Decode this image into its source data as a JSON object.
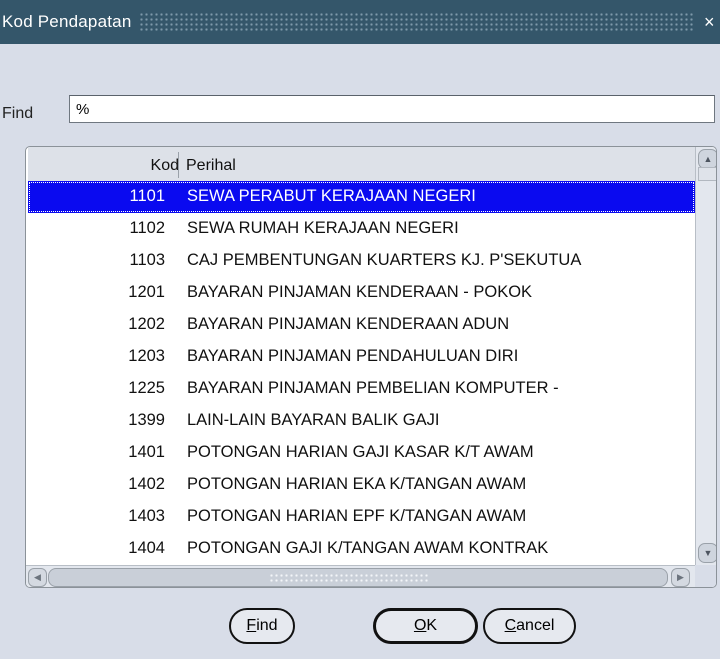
{
  "window": {
    "title": "Kod Pendapatan",
    "close_symbol": "×"
  },
  "search": {
    "label": "Find",
    "value": "%"
  },
  "table": {
    "columns": {
      "kod": "Kod",
      "perihal": "Perihal"
    },
    "selected_index": 0,
    "rows": [
      {
        "kod": "1101",
        "perihal": "SEWA PERABUT KERAJAAN NEGERI"
      },
      {
        "kod": "1102",
        "perihal": "SEWA RUMAH KERAJAAN NEGERI"
      },
      {
        "kod": "1103",
        "perihal": "CAJ PEMBENTUNGAN KUARTERS KJ. P'SEKUTUA"
      },
      {
        "kod": "1201",
        "perihal": "BAYARAN PINJAMAN KENDERAAN - POKOK"
      },
      {
        "kod": "1202",
        "perihal": "BAYARAN PINJAMAN KENDERAAN ADUN"
      },
      {
        "kod": "1203",
        "perihal": "BAYARAN PINJAMAN PENDAHULUAN DIRI"
      },
      {
        "kod": "1225",
        "perihal": "BAYARAN PINJAMAN PEMBELIAN KOMPUTER -"
      },
      {
        "kod": "1399",
        "perihal": "LAIN-LAIN BAYARAN BALIK GAJI"
      },
      {
        "kod": "1401",
        "perihal": "POTONGAN HARIAN GAJI KASAR K/T AWAM"
      },
      {
        "kod": "1402",
        "perihal": "POTONGAN HARIAN EKA K/TANGAN AWAM"
      },
      {
        "kod": "1403",
        "perihal": "POTONGAN HARIAN EPF K/TANGAN AWAM"
      },
      {
        "kod": "1404",
        "perihal": "POTONGAN GAJI K/TANGAN AWAM KONTRAK"
      }
    ]
  },
  "buttons": {
    "find": {
      "mnemonic": "F",
      "rest": "ind"
    },
    "ok": {
      "mnemonic": "O",
      "rest": "K"
    },
    "cancel": {
      "mnemonic": "C",
      "rest": "ancel"
    }
  },
  "colors": {
    "titlebar": "#34566a",
    "selection": "#0a0af0",
    "background": "#d8dde8"
  }
}
